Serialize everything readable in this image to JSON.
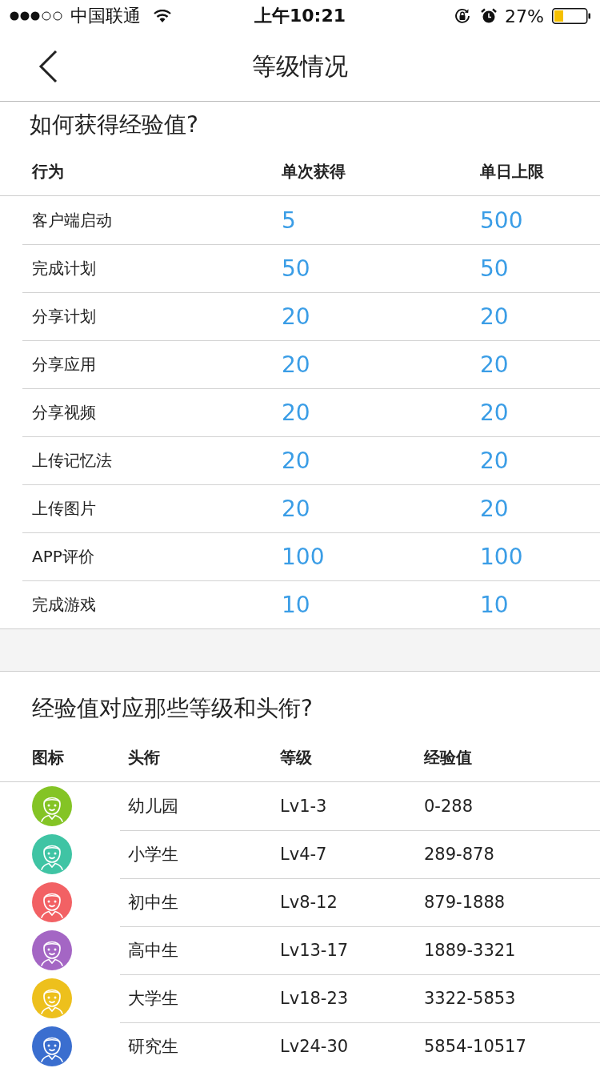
{
  "status_bar": {
    "carrier": "中国联通",
    "time": "上午10:21",
    "battery": "27%"
  },
  "nav": {
    "title": "等级情况"
  },
  "earn_section": {
    "title": "如何获得经验值?",
    "columns": [
      "行为",
      "单次获得",
      "单日上限"
    ],
    "rows": [
      {
        "action": "客户端启动",
        "per_time": "5",
        "daily_limit": "500"
      },
      {
        "action": "完成计划",
        "per_time": "50",
        "daily_limit": "50"
      },
      {
        "action": "分享计划",
        "per_time": "20",
        "daily_limit": "20"
      },
      {
        "action": "分享应用",
        "per_time": "20",
        "daily_limit": "20"
      },
      {
        "action": "分享视频",
        "per_time": "20",
        "daily_limit": "20"
      },
      {
        "action": "上传记忆法",
        "per_time": "20",
        "daily_limit": "20"
      },
      {
        "action": "上传图片",
        "per_time": "20",
        "daily_limit": "20"
      },
      {
        "action": "APP评价",
        "per_time": "100",
        "daily_limit": "100"
      },
      {
        "action": "完成游戏",
        "per_time": "10",
        "daily_limit": "10"
      }
    ]
  },
  "levels_section": {
    "title": "经验值对应那些等级和头衔?",
    "columns": [
      "图标",
      "头衔",
      "等级",
      "经验值"
    ],
    "rows": [
      {
        "color": "#84c425",
        "title": "幼儿园",
        "grade": "Lv1-3",
        "exp": "0-288"
      },
      {
        "color": "#3fc4a4",
        "title": "小学生",
        "grade": "Lv4-7",
        "exp": "289-878"
      },
      {
        "color": "#f26164",
        "title": "初中生",
        "grade": "Lv8-12",
        "exp": "879-1888"
      },
      {
        "color": "#a466c4",
        "title": "高中生",
        "grade": "Lv13-17",
        "exp": "1889-3321"
      },
      {
        "color": "#edc01c",
        "title": "大学生",
        "grade": "Lv18-23",
        "exp": "3322-5853"
      },
      {
        "color": "#3a6ecf",
        "title": "研究生",
        "grade": "Lv24-30",
        "exp": "5854-10517"
      }
    ]
  }
}
